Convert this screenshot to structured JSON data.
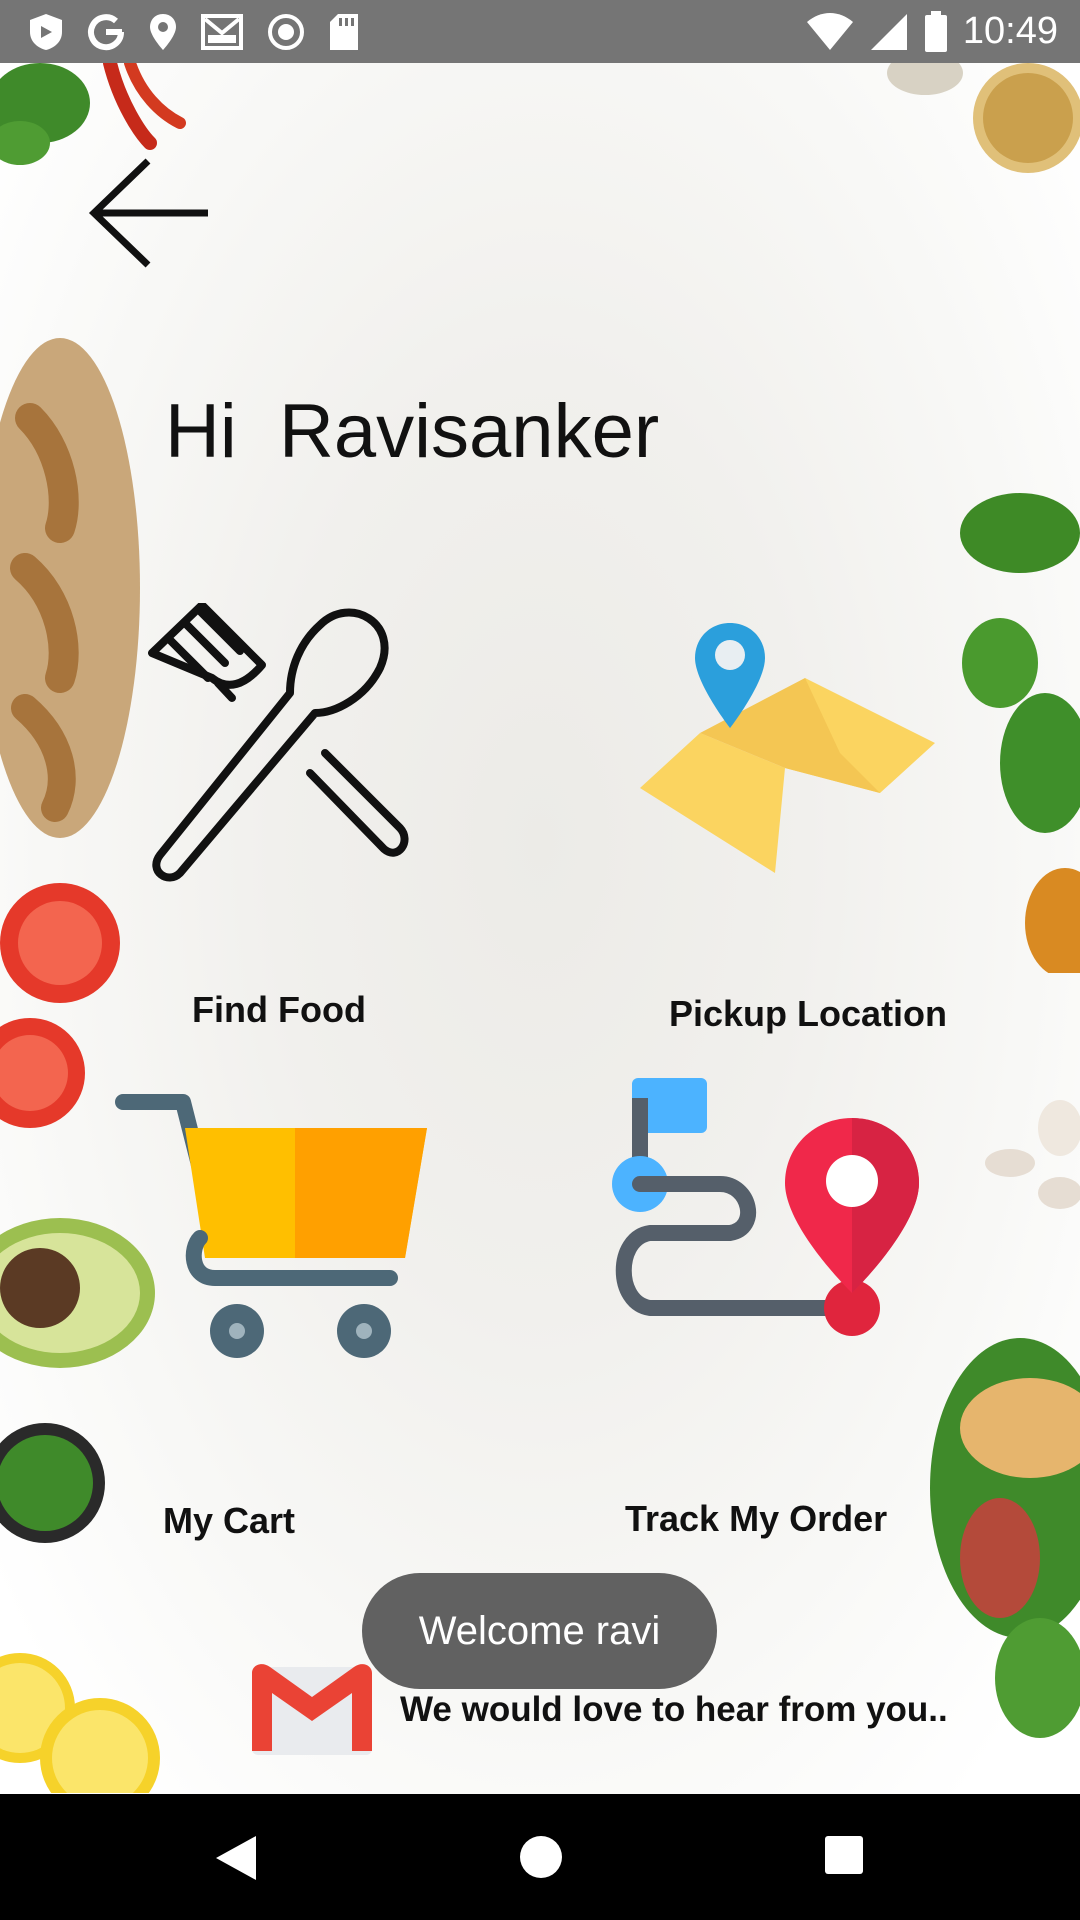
{
  "status_bar": {
    "time": "10:49",
    "left_icons": [
      "shield-icon",
      "google-icon",
      "location-pin-icon",
      "gmail-icon",
      "record-icon",
      "sd-card-icon"
    ],
    "right_icons": [
      "wifi-icon",
      "signal-icon",
      "battery-icon"
    ]
  },
  "header": {
    "back_icon": "arrow-left-icon"
  },
  "greeting": "Hi  Ravisanker",
  "menu": {
    "find_food": {
      "label": "Find Food",
      "icon": "fork-spoon-icon"
    },
    "pickup_location": {
      "label": "Pickup Location",
      "icon": "map-pin-icon"
    },
    "my_cart": {
      "label": "My Cart",
      "icon": "shopping-cart-icon"
    },
    "track_order": {
      "label": "Track My Order",
      "icon": "route-icon"
    }
  },
  "toast": "Welcome ravi",
  "feedback": {
    "label": "We would love to hear from you..",
    "icon": "gmail-icon"
  },
  "nav_bar": {
    "icons": [
      "back-triangle-icon",
      "home-circle-icon",
      "recents-square-icon"
    ]
  },
  "colors": {
    "status_bar": "#757575",
    "toast": "#616161",
    "cart_yellow": "#ffbf00",
    "cart_orange": "#ffa000",
    "pin_red": "#f0284a",
    "pin_blue": "#2b9fdc",
    "map_yellow": "#fbd460"
  }
}
